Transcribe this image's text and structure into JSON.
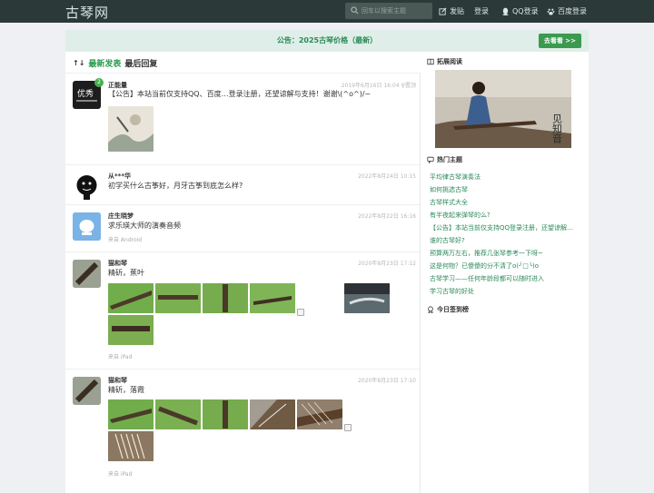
{
  "header": {
    "logo": "古琴网",
    "search_placeholder": "回车以搜索主题",
    "nav": {
      "post": "发贴",
      "login": "登录",
      "qq_login": "QQ登录",
      "baidu_login": "百度登录"
    }
  },
  "notice": {
    "text": "公告：2025古琴价格（最新）",
    "button": "去看看 >>"
  },
  "tabs": {
    "sort_icon": "↑↓",
    "latest": "最新发表",
    "reply": "最后回复"
  },
  "posts": [
    {
      "name": "正能量",
      "time": "2019年6月16日 16:04",
      "sticky": "置顶",
      "badge": "2",
      "body": "【公告】本站当前仅支持QQ、百度…登录注册，还望谅解与支持！谢谢\\(^o^)/~"
    },
    {
      "name": "从***华",
      "time": "2022年8月24日 10:15",
      "body": "初学买什么古筝好，月牙古筝到底怎么样?"
    },
    {
      "name": "庄生晓梦",
      "time": "2022年8月22日 16:16",
      "body": "求乐瑛大师的演奏音频",
      "source": "来自 Android"
    },
    {
      "name": "猫和琴",
      "time": "2020年8月23日 17:12",
      "body": "精斫，蕉叶",
      "source": "来自 iPad"
    },
    {
      "name": "猫和琴",
      "time": "2020年8月23日 17:10",
      "body": "精斫，落霞",
      "source": "来自 iPad"
    }
  ],
  "sidebar": {
    "ext_title": "拓展阅读",
    "ext_image_caption": "见知音",
    "hot_title": "热门主题",
    "hot": [
      "平均律古琴演奏法",
      "如何挑选古琴",
      "古琴样式大全",
      "有半夜起来弹琴的么?",
      "【公告】本站当前仅支持QQ登录注册，还望谅解…",
      "谁的古琴好?",
      "预算两万左右，推荐几张琴参考一下呀~",
      "这是何物？已傻傻的分不清了o(╯□╰)o",
      "古琴学习——任何年龄段都可以随时进入",
      "学习古琴的好处"
    ],
    "sign_title": "今日签到榜"
  },
  "colors": {
    "topbar": "#2b3a38",
    "accent": "#2c9a4d",
    "notice_bg": "#dfeee8"
  }
}
